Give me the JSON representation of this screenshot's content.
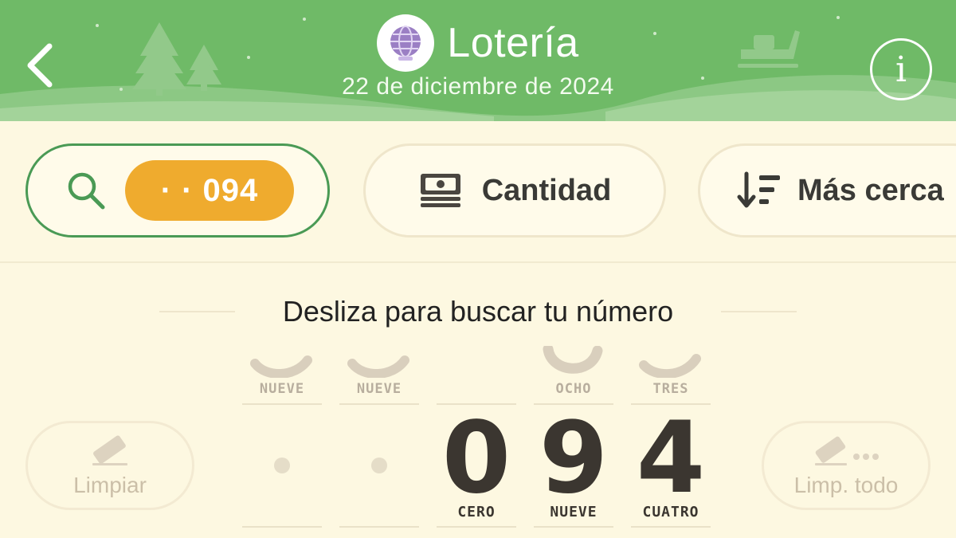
{
  "header": {
    "title": "Lotería",
    "date": "22 de diciembre de 2024",
    "back_icon": "chevron-left-icon",
    "info_label": "i",
    "logo_icon": "lottery-globe-icon",
    "background_color": "#6fba67"
  },
  "filters": {
    "search_icon": "search-icon",
    "search_value": "· · 094",
    "amount_icon": "banknotes-icon",
    "amount_label": "Cantidad",
    "sort_icon": "sort-descending-icon",
    "sort_label": "Más cerca",
    "accent_color": "#efab2e",
    "active_border_color": "#4a9a55"
  },
  "picker": {
    "instruction": "Desliza para buscar tu número",
    "clear_label": "Limpiar",
    "clear_all_label": "Limp. todo",
    "clear_icon": "eraser-icon",
    "clear_all_icon": "eraser-more-icon",
    "columns": [
      {
        "top_word": "NUEVE",
        "digit": "",
        "bottom_word": "",
        "empty": true
      },
      {
        "top_word": "NUEVE",
        "digit": "",
        "bottom_word": "",
        "empty": true
      },
      {
        "top_word": "",
        "digit": "0",
        "bottom_word": "CERO",
        "empty": false
      },
      {
        "top_word": "OCHO",
        "digit": "9",
        "bottom_word": "NUEVE",
        "empty": false
      },
      {
        "top_word": "TRES",
        "digit": "4",
        "bottom_word": "CUATRO",
        "empty": false
      }
    ]
  }
}
